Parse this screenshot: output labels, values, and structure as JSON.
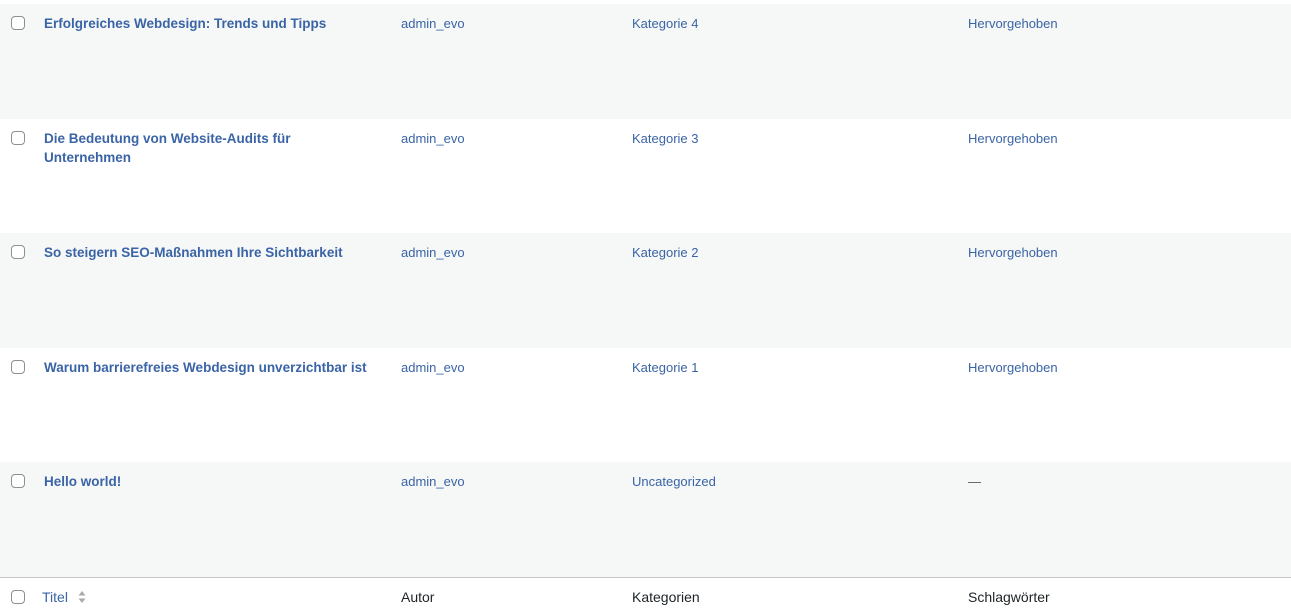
{
  "posts": [
    {
      "title": "Erfolgreiches Webdesign: Trends und Tipps",
      "author": "admin_evo",
      "category": "Kategorie 4",
      "tags": "Hervorgehoben"
    },
    {
      "title": "Die Bedeutung von Website-Audits für Unternehmen",
      "author": "admin_evo",
      "category": "Kategorie 3",
      "tags": "Hervorgehoben"
    },
    {
      "title": "So steigern SEO-Maßnahmen Ihre Sichtbarkeit",
      "author": "admin_evo",
      "category": "Kategorie 2",
      "tags": "Hervorgehoben"
    },
    {
      "title": "Warum barrierefreies Webdesign unverzichtbar ist",
      "author": "admin_evo",
      "category": "Kategorie 1",
      "tags": "Hervorgehoben"
    },
    {
      "title": "Hello world!",
      "author": "admin_evo",
      "category": "Uncategorized",
      "tags": "—"
    }
  ],
  "footer": {
    "title": "Titel",
    "author": "Autor",
    "categories": "Kategorien",
    "tags": "Schlagwörter",
    "sort_icon": "sort-arrows-icon"
  }
}
